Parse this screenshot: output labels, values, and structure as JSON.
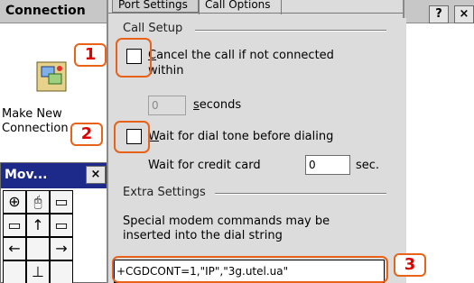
{
  "background_window": {
    "title": "Connection",
    "help_label": "?",
    "close_label": "×",
    "connection_icon": "modem-connection-icon",
    "new_connection_label_line1": "Make New",
    "new_connection_label_line2": "Connection"
  },
  "move_panel": {
    "title": "Mov...",
    "close_label": "×",
    "buttons": [
      "⊕",
      "🖰",
      "▭",
      "▭",
      "↑",
      "▭",
      "←",
      "",
      "→",
      "",
      "⊥",
      ""
    ]
  },
  "tabs": [
    {
      "label": "Port Settings"
    },
    {
      "label": "Call Options",
      "selected": true
    }
  ],
  "call_setup": {
    "section_title": "Call Setup",
    "cancel_call": {
      "checked": false,
      "label_prefix": "",
      "label_hotkey": "C",
      "label_rest": "ancel the call if not connected",
      "label_line2": "within"
    },
    "seconds_value": "0",
    "seconds_label_hotkey": "s",
    "seconds_label_rest": "econds",
    "wait_dial_tone": {
      "checked": false,
      "label_hotkey": "W",
      "label_rest": "ait for dial tone before dialing"
    },
    "credit_card_label": "Wait for credit card",
    "credit_card_value": "0",
    "credit_card_unit": "sec."
  },
  "extra_settings": {
    "section_title": "Extra Settings",
    "description_line1": "Special modem commands may be",
    "description_line2": "inserted into the dial string",
    "modem_command_value": "+CGDCONT=1,\"IP\",\"3g.utel.ua\""
  },
  "callouts": {
    "one": "1",
    "two": "2",
    "three": "3",
    "color": "#e8621a",
    "number_color": "#e00000"
  }
}
